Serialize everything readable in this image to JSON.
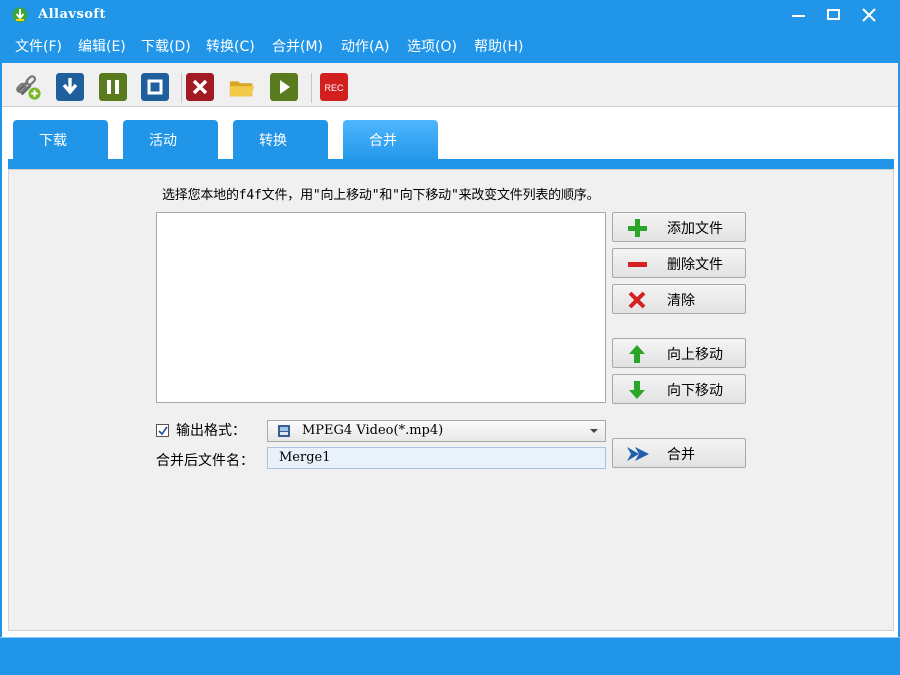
{
  "window": {
    "title": "Allavsoft"
  },
  "menu": [
    {
      "label": "文件(F)"
    },
    {
      "label": "编辑(E)"
    },
    {
      "label": "下载(D)"
    },
    {
      "label": "转换(C)"
    },
    {
      "label": "合并(M)"
    },
    {
      "label": "动作(A)"
    },
    {
      "label": "选项(O)"
    },
    {
      "label": "帮助(H)"
    }
  ],
  "toolbar": {
    "buttons": [
      {
        "icon": "add-link-icon"
      },
      {
        "icon": "download-icon",
        "color": "#1f5f9e"
      },
      {
        "icon": "pause-icon",
        "color": "#5a7a1e"
      },
      {
        "icon": "stop-icon",
        "color": "#1f5f9e"
      },
      {
        "icon": "cancel-icon",
        "color": "#a21a24"
      },
      {
        "icon": "folder-icon",
        "color": "#e8b830"
      },
      {
        "icon": "play-icon",
        "color": "#5a7a1e"
      },
      {
        "icon": "record-icon",
        "color": "#d41f1f",
        "label": "REC"
      }
    ]
  },
  "tabs": [
    {
      "label": "下载"
    },
    {
      "label": "活动"
    },
    {
      "label": "转换"
    },
    {
      "label": "合并",
      "active": true
    }
  ],
  "merge": {
    "instruction": "选择您本地的f4f文件，用\"向上移动\"和\"向下移动\"来改变文件列表的顺序。",
    "buttons": {
      "add": "添加文件",
      "delete": "删除文件",
      "clear": "清除",
      "move_up": "向上移动",
      "move_down": "向下移动",
      "merge": "合并"
    },
    "output_format_label": "输出格式：",
    "output_format_checked": true,
    "output_format_value": "MPEG4 Video(*.mp4)",
    "filename_label": "合并后文件名：",
    "filename_value": "Merge1"
  },
  "colors": {
    "accent": "#2196e8",
    "add_green": "#2aa52a",
    "delete_red": "#d42020"
  }
}
